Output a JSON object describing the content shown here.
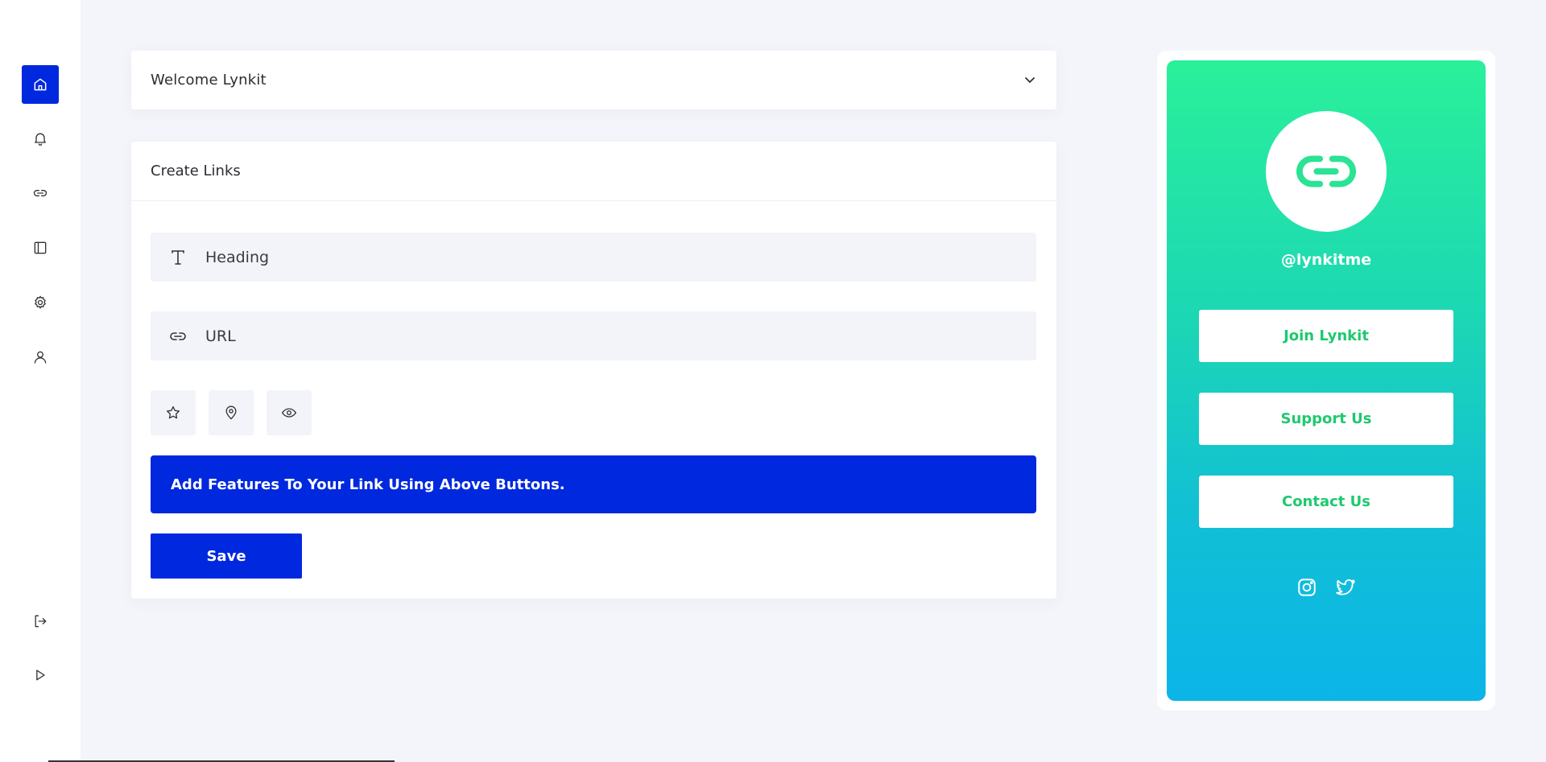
{
  "sidebar": {
    "items": [
      {
        "name": "home",
        "icon": "home-icon",
        "active": true
      },
      {
        "name": "notifications",
        "icon": "bell-icon"
      },
      {
        "name": "links",
        "icon": "link-icon"
      },
      {
        "name": "layout",
        "icon": "sidebar-panel-icon"
      },
      {
        "name": "settings",
        "icon": "gear-icon"
      },
      {
        "name": "profile",
        "icon": "user-icon"
      }
    ],
    "bottom": [
      {
        "name": "logout",
        "icon": "logout-icon"
      },
      {
        "name": "play",
        "icon": "play-icon"
      }
    ]
  },
  "welcome": {
    "title": "Welcome Lynkit"
  },
  "create": {
    "title": "Create Links",
    "heading_label": "Heading",
    "url_label": "URL",
    "feature_buttons": [
      "star-icon",
      "location-pin-icon",
      "eye-icon"
    ],
    "banner_text": "Add Features To Your Link Using Above Buttons.",
    "save_label": "Save"
  },
  "preview": {
    "handle": "@lynkitme",
    "links": [
      "Join Lynkit",
      "Support Us",
      "Contact Us"
    ],
    "socials": [
      "instagram-icon",
      "twitter-icon"
    ]
  },
  "colors": {
    "accent": "#0028de",
    "green": "#1ec96f",
    "gradient_top": "#2af09a",
    "gradient_bottom": "#0bb5e8"
  }
}
